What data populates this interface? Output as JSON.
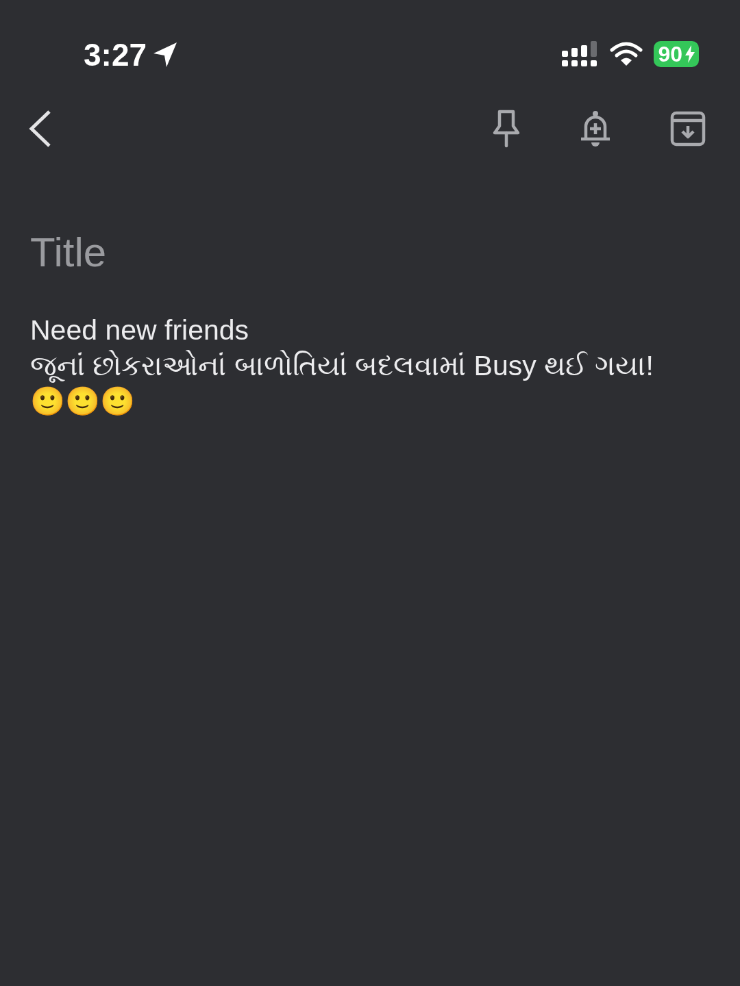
{
  "status_bar": {
    "time": "3:27",
    "battery": "90"
  },
  "note": {
    "title": {
      "placeholder": "Title"
    },
    "body": [
      "Need new friends",
      "જૂનાં છોકરાઓનાં બાળોતિયાં બદલવામાં Busy થઈ ગયા!",
      "🙂🙂🙂"
    ]
  }
}
